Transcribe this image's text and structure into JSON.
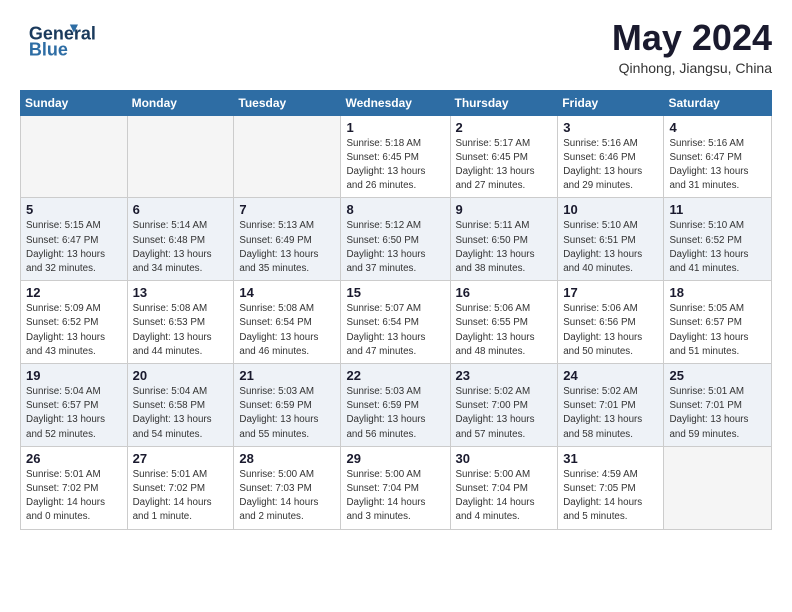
{
  "header": {
    "logo_line1": "General",
    "logo_line2": "Blue",
    "month_title": "May 2024",
    "subtitle": "Qinhong, Jiangsu, China"
  },
  "weekdays": [
    "Sunday",
    "Monday",
    "Tuesday",
    "Wednesday",
    "Thursday",
    "Friday",
    "Saturday"
  ],
  "weeks": [
    [
      {
        "day": "",
        "info": ""
      },
      {
        "day": "",
        "info": ""
      },
      {
        "day": "",
        "info": ""
      },
      {
        "day": "1",
        "info": "Sunrise: 5:18 AM\nSunset: 6:45 PM\nDaylight: 13 hours\nand 26 minutes."
      },
      {
        "day": "2",
        "info": "Sunrise: 5:17 AM\nSunset: 6:45 PM\nDaylight: 13 hours\nand 27 minutes."
      },
      {
        "day": "3",
        "info": "Sunrise: 5:16 AM\nSunset: 6:46 PM\nDaylight: 13 hours\nand 29 minutes."
      },
      {
        "day": "4",
        "info": "Sunrise: 5:16 AM\nSunset: 6:47 PM\nDaylight: 13 hours\nand 31 minutes."
      }
    ],
    [
      {
        "day": "5",
        "info": "Sunrise: 5:15 AM\nSunset: 6:47 PM\nDaylight: 13 hours\nand 32 minutes."
      },
      {
        "day": "6",
        "info": "Sunrise: 5:14 AM\nSunset: 6:48 PM\nDaylight: 13 hours\nand 34 minutes."
      },
      {
        "day": "7",
        "info": "Sunrise: 5:13 AM\nSunset: 6:49 PM\nDaylight: 13 hours\nand 35 minutes."
      },
      {
        "day": "8",
        "info": "Sunrise: 5:12 AM\nSunset: 6:50 PM\nDaylight: 13 hours\nand 37 minutes."
      },
      {
        "day": "9",
        "info": "Sunrise: 5:11 AM\nSunset: 6:50 PM\nDaylight: 13 hours\nand 38 minutes."
      },
      {
        "day": "10",
        "info": "Sunrise: 5:10 AM\nSunset: 6:51 PM\nDaylight: 13 hours\nand 40 minutes."
      },
      {
        "day": "11",
        "info": "Sunrise: 5:10 AM\nSunset: 6:52 PM\nDaylight: 13 hours\nand 41 minutes."
      }
    ],
    [
      {
        "day": "12",
        "info": "Sunrise: 5:09 AM\nSunset: 6:52 PM\nDaylight: 13 hours\nand 43 minutes."
      },
      {
        "day": "13",
        "info": "Sunrise: 5:08 AM\nSunset: 6:53 PM\nDaylight: 13 hours\nand 44 minutes."
      },
      {
        "day": "14",
        "info": "Sunrise: 5:08 AM\nSunset: 6:54 PM\nDaylight: 13 hours\nand 46 minutes."
      },
      {
        "day": "15",
        "info": "Sunrise: 5:07 AM\nSunset: 6:54 PM\nDaylight: 13 hours\nand 47 minutes."
      },
      {
        "day": "16",
        "info": "Sunrise: 5:06 AM\nSunset: 6:55 PM\nDaylight: 13 hours\nand 48 minutes."
      },
      {
        "day": "17",
        "info": "Sunrise: 5:06 AM\nSunset: 6:56 PM\nDaylight: 13 hours\nand 50 minutes."
      },
      {
        "day": "18",
        "info": "Sunrise: 5:05 AM\nSunset: 6:57 PM\nDaylight: 13 hours\nand 51 minutes."
      }
    ],
    [
      {
        "day": "19",
        "info": "Sunrise: 5:04 AM\nSunset: 6:57 PM\nDaylight: 13 hours\nand 52 minutes."
      },
      {
        "day": "20",
        "info": "Sunrise: 5:04 AM\nSunset: 6:58 PM\nDaylight: 13 hours\nand 54 minutes."
      },
      {
        "day": "21",
        "info": "Sunrise: 5:03 AM\nSunset: 6:59 PM\nDaylight: 13 hours\nand 55 minutes."
      },
      {
        "day": "22",
        "info": "Sunrise: 5:03 AM\nSunset: 6:59 PM\nDaylight: 13 hours\nand 56 minutes."
      },
      {
        "day": "23",
        "info": "Sunrise: 5:02 AM\nSunset: 7:00 PM\nDaylight: 13 hours\nand 57 minutes."
      },
      {
        "day": "24",
        "info": "Sunrise: 5:02 AM\nSunset: 7:01 PM\nDaylight: 13 hours\nand 58 minutes."
      },
      {
        "day": "25",
        "info": "Sunrise: 5:01 AM\nSunset: 7:01 PM\nDaylight: 13 hours\nand 59 minutes."
      }
    ],
    [
      {
        "day": "26",
        "info": "Sunrise: 5:01 AM\nSunset: 7:02 PM\nDaylight: 14 hours\nand 0 minutes."
      },
      {
        "day": "27",
        "info": "Sunrise: 5:01 AM\nSunset: 7:02 PM\nDaylight: 14 hours\nand 1 minute."
      },
      {
        "day": "28",
        "info": "Sunrise: 5:00 AM\nSunset: 7:03 PM\nDaylight: 14 hours\nand 2 minutes."
      },
      {
        "day": "29",
        "info": "Sunrise: 5:00 AM\nSunset: 7:04 PM\nDaylight: 14 hours\nand 3 minutes."
      },
      {
        "day": "30",
        "info": "Sunrise: 5:00 AM\nSunset: 7:04 PM\nDaylight: 14 hours\nand 4 minutes."
      },
      {
        "day": "31",
        "info": "Sunrise: 4:59 AM\nSunset: 7:05 PM\nDaylight: 14 hours\nand 5 minutes."
      },
      {
        "day": "",
        "info": ""
      }
    ]
  ]
}
